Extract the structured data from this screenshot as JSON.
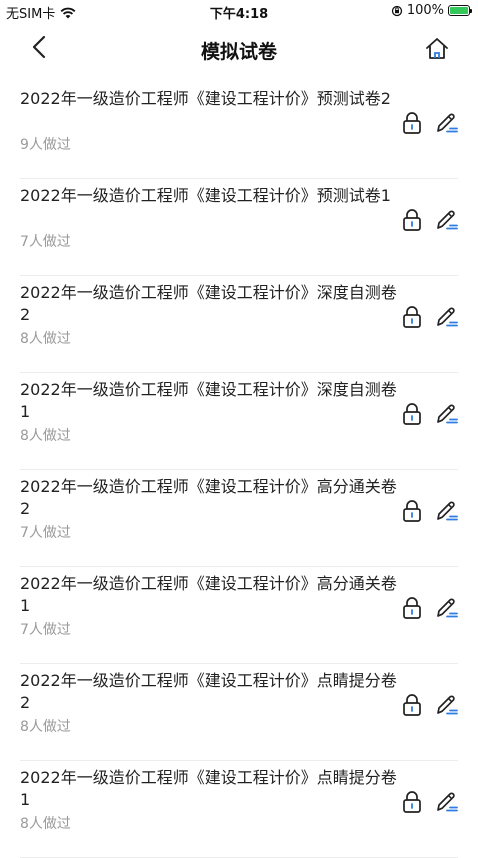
{
  "status_bar": {
    "carrier": "无SIM卡",
    "time": "下午4:18",
    "battery": "100%"
  },
  "nav": {
    "title": "模拟试卷"
  },
  "items": [
    {
      "title": "2022年一级造价工程师《建设工程计价》预测试卷2",
      "count": "9人做过"
    },
    {
      "title": "2022年一级造价工程师《建设工程计价》预测试卷1",
      "count": "7人做过"
    },
    {
      "title": "2022年一级造价工程师《建设工程计价》深度自测卷2",
      "count": "8人做过"
    },
    {
      "title": "2022年一级造价工程师《建设工程计价》深度自测卷1",
      "count": "8人做过"
    },
    {
      "title": "2022年一级造价工程师《建设工程计价》高分通关卷2",
      "count": "7人做过"
    },
    {
      "title": "2022年一级造价工程师《建设工程计价》高分通关卷1",
      "count": "7人做过"
    },
    {
      "title": "2022年一级造价工程师《建设工程计价》点睛提分卷2",
      "count": "8人做过"
    },
    {
      "title": "2022年一级造价工程师《建设工程计价》点睛提分卷1",
      "count": "8人做过"
    }
  ],
  "colors": {
    "accent": "#2f7de1",
    "text": "#222222",
    "subtext": "#9a9a9a"
  }
}
